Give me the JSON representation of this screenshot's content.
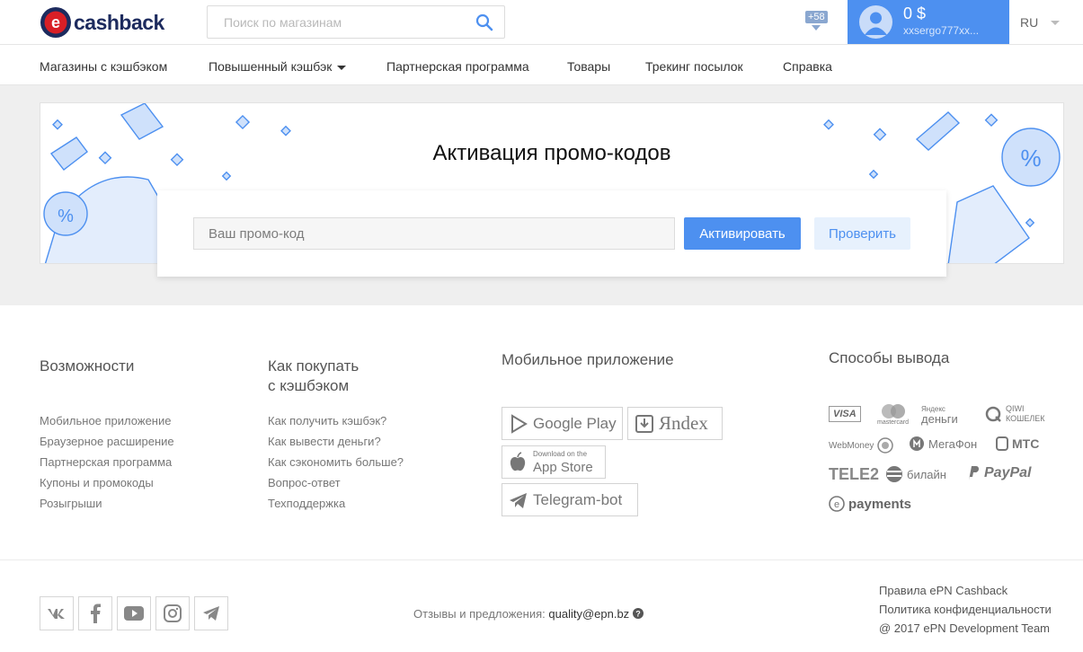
{
  "header": {
    "logo_text": "cashback",
    "search_placeholder": "Поиск по магазинам",
    "notifications_count": "+58",
    "balance": "0 $",
    "username": "xxsergo777xx...",
    "language": "RU"
  },
  "nav": {
    "items": [
      {
        "label": "Магазины с кэшбэком"
      },
      {
        "label": "Повышенный кэшбэк"
      },
      {
        "label": "Партнерская программа"
      },
      {
        "label": "Товары"
      },
      {
        "label": "Трекинг посылок"
      },
      {
        "label": "Справка"
      }
    ]
  },
  "promo": {
    "title": "Активация промо-кодов",
    "input_placeholder": "Ваш промо-код",
    "activate_label": "Активировать",
    "check_label": "Проверить"
  },
  "footer": {
    "features_title": "Возможности",
    "features": [
      "Мобильное приложение",
      "Браузерное расширение",
      "Партнерская программа",
      "Купоны и промокоды",
      "Розыгрыши"
    ],
    "howto_title_1": "Как покупать",
    "howto_title_2": "с кэшбэком",
    "howto": [
      "Как получить кэшбэк?",
      "Как вывести деньги?",
      "Как сэкономить больше?",
      "Вопрос-ответ",
      "Техподдержка"
    ],
    "mobile_title": "Мобильное приложение",
    "stores": {
      "google_play": "Google Play",
      "yandex": "Яndex",
      "appstore_small": "Download on the",
      "appstore": "App Store",
      "telegram": "Telegram-bot"
    },
    "withdraw_title": "Способы вывода",
    "payments": {
      "visa": "VISA",
      "mastercard": "mastercard",
      "yandex_1": "Яндекс",
      "yandex_2": "деньги",
      "qiwi_1": "QIWI",
      "qiwi_2": "КОШЕЛЕК",
      "webmoney": "WebMoney",
      "megafon": "МегаФон",
      "mts": "МТС",
      "tele2": "TELE2",
      "beeline": "билайн",
      "paypal": "PayPal",
      "epayments": "payments"
    },
    "feedback_text": "Отзывы и предложения:",
    "feedback_email": "quality@epn.bz",
    "legal": [
      "Правила ePN Cashback",
      "Политика конфиденциальности",
      "@ 2017 ePN Development Team"
    ]
  },
  "colors": {
    "accent": "#4d90f0",
    "brand_dark": "#1d2b5e",
    "brand_red": "#d81f26"
  }
}
